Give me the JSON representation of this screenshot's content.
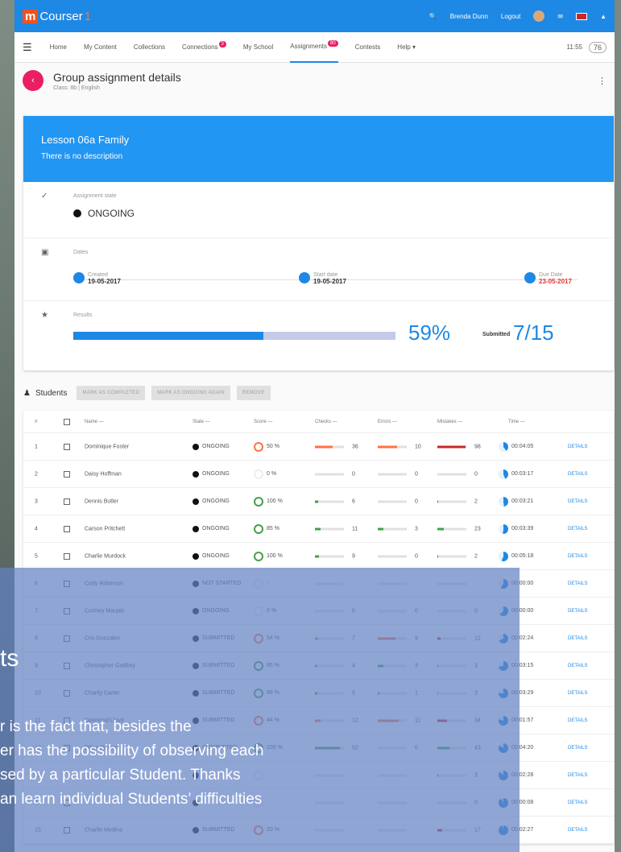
{
  "app": {
    "logo_m": "m",
    "logo_text": "Courser",
    "logo_one": "1"
  },
  "topbar": {
    "user": "Brenda Dunn",
    "logout": "Logout"
  },
  "nav": {
    "items": [
      {
        "label": "Home",
        "badge": ""
      },
      {
        "label": "My Content",
        "badge": ""
      },
      {
        "label": "Collections",
        "badge": ""
      },
      {
        "label": "Connections",
        "badge": "3"
      },
      {
        "label": "My School",
        "badge": ""
      },
      {
        "label": "Assignments",
        "badge": "80"
      },
      {
        "label": "Contests",
        "badge": ""
      },
      {
        "label": "Help",
        "badge": ""
      }
    ],
    "time": "11:55",
    "laurel": "76"
  },
  "header": {
    "title": "Group assignment details",
    "subtitle": "Class: 8b | English"
  },
  "lesson": {
    "title": "Lesson 06a Family",
    "description": "There is no description"
  },
  "assignment": {
    "state_label": "Assignment state",
    "state": "ONGOING"
  },
  "dates": {
    "label": "Dates",
    "created_label": "Created",
    "created": "19-05-2017",
    "start_label": "Start date",
    "start": "19-05-2017",
    "due_label": "Due Date",
    "due": "23-05-2017"
  },
  "results": {
    "label": "Results",
    "progress": 0.59,
    "percent": "59%",
    "submitted_label": "Submitted",
    "submitted": "7/15"
  },
  "students": {
    "title": "Students",
    "buttons": [
      "MARK AS COMPLETED",
      "MARK AS ONGOING AGAIN",
      "REMOVE"
    ],
    "columns": [
      "#",
      "Name —",
      "State —",
      "Score —",
      "Checks —",
      "Errors —",
      "Mistakes —",
      "Time —"
    ],
    "rows": [
      {
        "n": "1",
        "name": "Dominique Foster",
        "state": "ONGOING",
        "score": "50 %",
        "checks": "36",
        "errors": "10",
        "mistakes": "98",
        "time": "00:04:05",
        "details": "DETAILS"
      },
      {
        "n": "2",
        "name": "Daisy Hoffman",
        "state": "ONGOING",
        "score": "0 %",
        "checks": "0",
        "errors": "0",
        "mistakes": "0",
        "time": "00:03:17",
        "details": "DETAILS"
      },
      {
        "n": "3",
        "name": "Dennis Butler",
        "state": "ONGOING",
        "score": "100 %",
        "checks": "6",
        "errors": "0",
        "mistakes": "2",
        "time": "00:03:21",
        "details": "DETAILS"
      },
      {
        "n": "4",
        "name": "Carson Pritchett",
        "state": "ONGOING",
        "score": "85 %",
        "checks": "11",
        "errors": "3",
        "mistakes": "23",
        "time": "00:03:39",
        "details": "DETAILS"
      },
      {
        "n": "5",
        "name": "Charlie Murdock",
        "state": "ONGOING",
        "score": "100 %",
        "checks": "9",
        "errors": "0",
        "mistakes": "2",
        "time": "00:05:18",
        "details": "DETAILS"
      },
      {
        "n": "6",
        "name": "Cody Robinson",
        "state": "NOT STARTED",
        "score": "-",
        "checks": "",
        "errors": "",
        "mistakes": "",
        "time": "00:00:00",
        "details": "DETAILS"
      },
      {
        "n": "7",
        "name": "Cortney Maupin",
        "state": "ONGOING",
        "score": "0 %",
        "checks": "0",
        "errors": "0",
        "mistakes": "0",
        "time": "00:00:00",
        "details": "DETAILS"
      },
      {
        "n": "8",
        "name": "Cris Gonzales",
        "state": "SUBMITTED",
        "score": "54 %",
        "checks": "7",
        "errors": "9",
        "mistakes": "12",
        "time": "00:02:24",
        "details": "DETAILS"
      },
      {
        "n": "9",
        "name": "Christopher Godfrey",
        "state": "SUBMITTED",
        "score": "85 %",
        "checks": "4",
        "errors": "3",
        "mistakes": "3",
        "time": "00:03:15",
        "details": "DETAILS"
      },
      {
        "n": "10",
        "name": "Charity Carter",
        "state": "SUBMITTED",
        "score": "89 %",
        "checks": "5",
        "errors": "1",
        "mistakes": "3",
        "time": "00:03:29",
        "details": "DETAILS"
      },
      {
        "n": "11",
        "name": "Desmond Lloyd",
        "state": "SUBMITTED",
        "score": "44 %",
        "checks": "12",
        "errors": "11",
        "mistakes": "34",
        "time": "00:01:57",
        "details": "DETAILS"
      },
      {
        "n": "12",
        "name": "Dillan Paxton",
        "state": "COMPLETED",
        "score": "100 %",
        "checks": "52",
        "errors": "0",
        "mistakes": "43",
        "time": "00:04:20",
        "details": "DETAILS"
      },
      {
        "n": "13",
        "name": "",
        "state": "",
        "score": "",
        "checks": "",
        "errors": "",
        "mistakes": "3",
        "time": "00:02:28",
        "details": "DETAILS"
      },
      {
        "n": "14",
        "name": "",
        "state": "",
        "score": "",
        "checks": "",
        "errors": "",
        "mistakes": "0",
        "time": "00:00:08",
        "details": "DETAILS"
      },
      {
        "n": "15",
        "name": "Charlie Medina",
        "state": "SUBMITTED",
        "score": "20 %",
        "checks": "",
        "errors": "",
        "mistakes": "17",
        "time": "00:02:27",
        "details": "DETAILS"
      }
    ]
  },
  "overlay": {
    "title": "ts",
    "lines": [
      "r is the fact that, besides the",
      "er has the possibility of observing each",
      "sed by a particular Student. Thanks",
      "an learn individual Students’ difficulties"
    ]
  },
  "colors": {
    "primary": "#1e88e5",
    "accent": "#e91e63",
    "overlay": "#6482c3"
  }
}
